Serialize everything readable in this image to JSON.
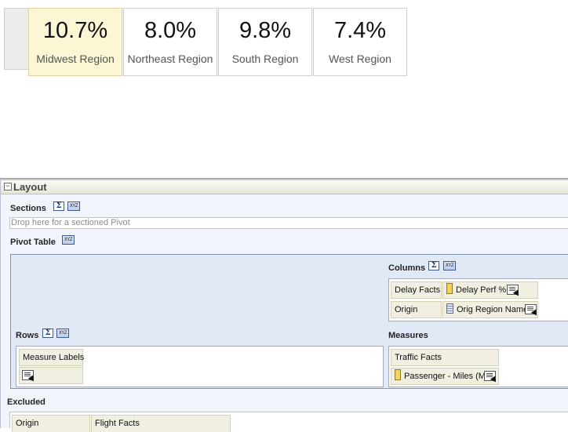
{
  "tiles": [
    {
      "value": "10.7%",
      "label": "Midwest Region",
      "selected": true
    },
    {
      "value": "8.0%",
      "label": "Northeast Region",
      "selected": false
    },
    {
      "value": "9.8%",
      "label": "South Region",
      "selected": false
    },
    {
      "value": "7.4%",
      "label": "West Region",
      "selected": false
    }
  ],
  "layout": {
    "title": "Layout",
    "sections": {
      "label": "Sections",
      "drop_placeholder": "Drop here for a sectioned Pivot"
    },
    "pivot_table": {
      "label": "Pivot Table",
      "columns": {
        "label": "Columns",
        "rows": [
          {
            "source": "Delay Facts",
            "column": "Delay Perf %"
          },
          {
            "source": "Origin",
            "column": "Orig Region Name"
          }
        ]
      },
      "rows": {
        "label": "Rows",
        "items": [
          "Measure Labels"
        ]
      },
      "measures": {
        "label": "Measures",
        "source": "Traffic Facts",
        "column": "Passenger - Miles (M)"
      }
    },
    "excluded": {
      "label": "Excluded",
      "items": [
        "Origin",
        "Flight Facts"
      ]
    }
  },
  "colors": {
    "selected_tile_bg": "#fbf7d4",
    "pivot_bg": "#e2e9f6",
    "chip_bg": "#f0efe1"
  },
  "icons": {
    "sigma": "Σ",
    "xyz": "XYZ"
  }
}
